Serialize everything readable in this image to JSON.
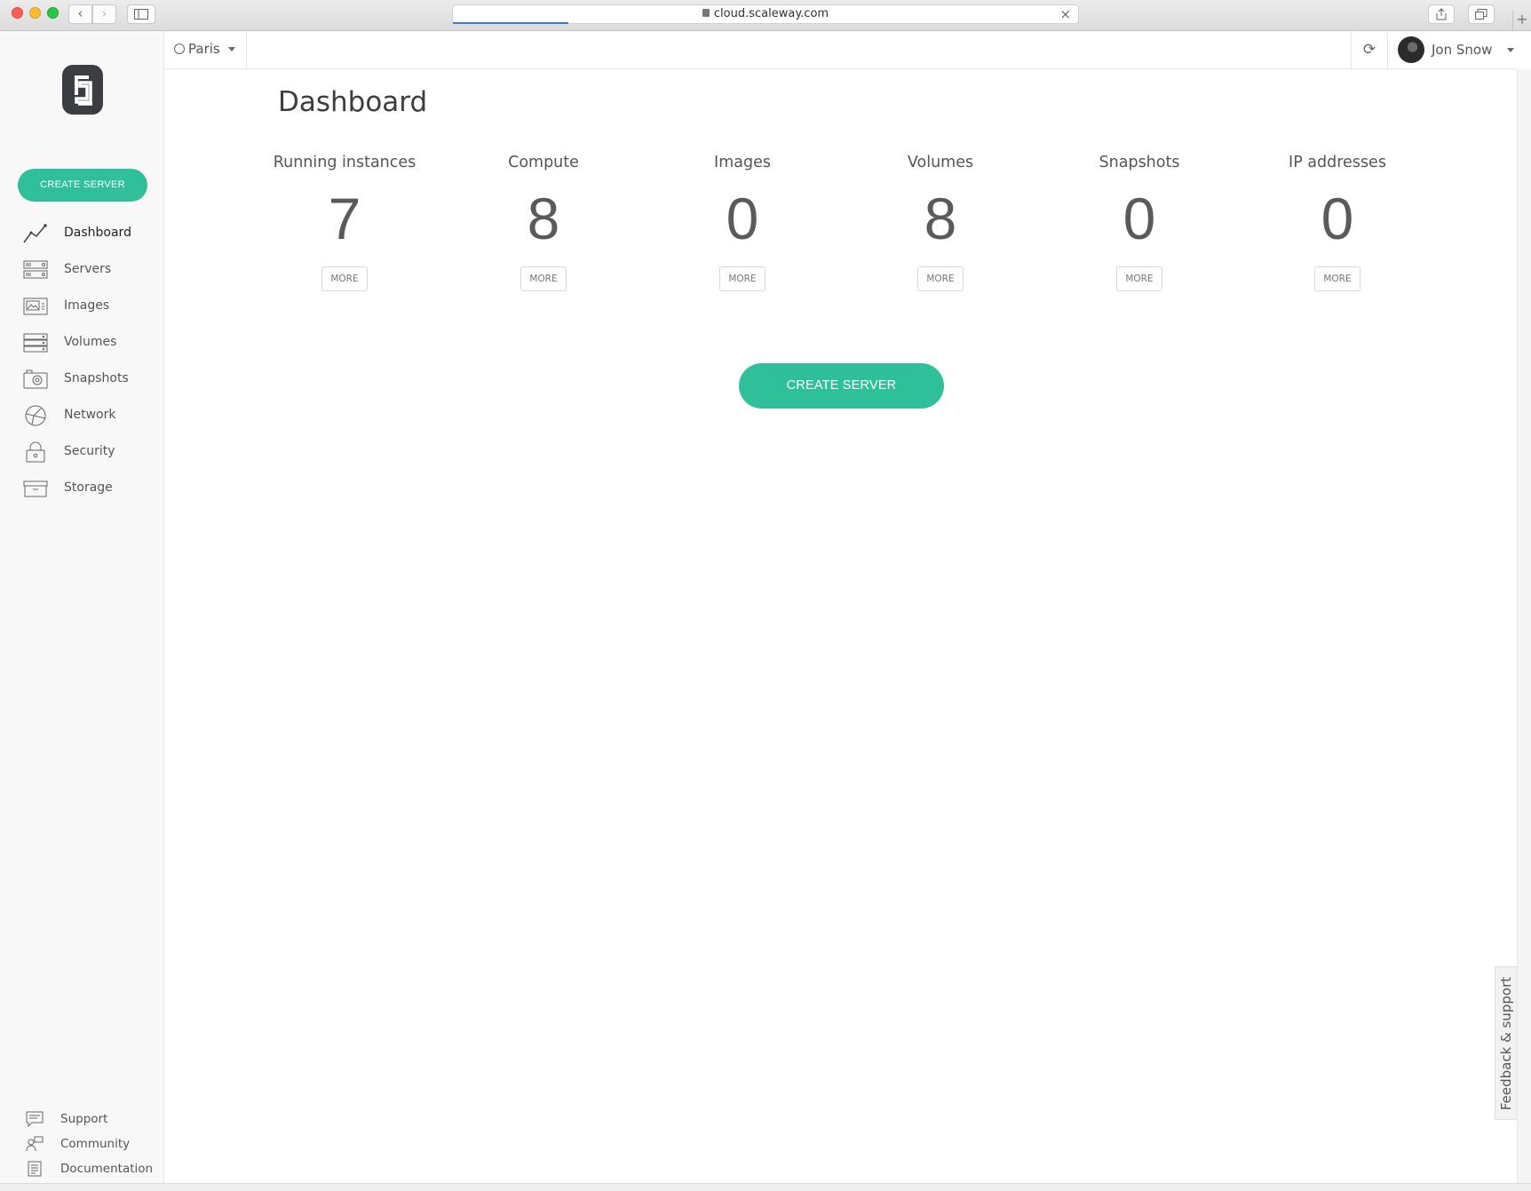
{
  "browser": {
    "url": "cloud.scaleway.com"
  },
  "sidebar": {
    "create_button": "CREATE SERVER",
    "items": [
      {
        "label": "Dashboard",
        "icon": "chart-line-icon",
        "active": true
      },
      {
        "label": "Servers",
        "icon": "server-icon"
      },
      {
        "label": "Images",
        "icon": "image-icon"
      },
      {
        "label": "Volumes",
        "icon": "volume-icon"
      },
      {
        "label": "Snapshots",
        "icon": "camera-icon"
      },
      {
        "label": "Network",
        "icon": "globe-icon"
      },
      {
        "label": "Security",
        "icon": "lock-icon"
      },
      {
        "label": "Storage",
        "icon": "storage-box-icon"
      }
    ],
    "bottom_items": [
      {
        "label": "Support",
        "icon": "chat-icon"
      },
      {
        "label": "Community",
        "icon": "people-icon"
      },
      {
        "label": "Documentation",
        "icon": "document-icon"
      }
    ]
  },
  "topbar": {
    "region": "Paris",
    "user_name": "Jon Snow"
  },
  "main": {
    "title": "Dashboard",
    "stats": [
      {
        "label": "Running instances",
        "value": "7",
        "more": "MORE"
      },
      {
        "label": "Compute",
        "value": "8",
        "more": "MORE"
      },
      {
        "label": "Images",
        "value": "0",
        "more": "MORE"
      },
      {
        "label": "Volumes",
        "value": "8",
        "more": "MORE"
      },
      {
        "label": "Snapshots",
        "value": "0",
        "more": "MORE"
      },
      {
        "label": "IP addresses",
        "value": "0",
        "more": "MORE"
      }
    ],
    "create_button": "CREATE SERVER"
  },
  "feedback": {
    "label": "Feedback & support"
  },
  "colors": {
    "accent": "#2fc09a",
    "logo": "#3b3d42"
  }
}
